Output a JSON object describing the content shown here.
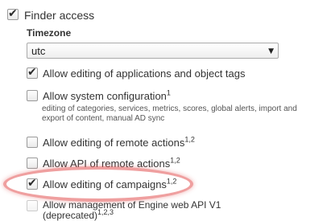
{
  "finder_access": {
    "label": "Finder access",
    "checked": true
  },
  "timezone": {
    "label": "Timezone",
    "value": "utc",
    "arrow": "▼"
  },
  "options": [
    {
      "label": "Allow editing of applications and object tags",
      "sup": "",
      "checked": true
    },
    {
      "label": "Allow system configuration",
      "sup": "1",
      "checked": false,
      "desc_line1": "editing of categories, services, metrics, scores, global alerts, import and",
      "desc_line2": "export of content, manual AD sync"
    },
    {
      "label": "Allow editing of remote actions",
      "sup": "1,2",
      "checked": false
    },
    {
      "label": "Allow API of remote actions",
      "sup": "1,2",
      "checked": false
    },
    {
      "label": "Allow editing of campaigns",
      "sup": "1,2",
      "checked": true
    },
    {
      "label_line1": "Allow management of Engine web API V1",
      "label_line2": "(deprecated)",
      "sup": "1,2,3",
      "checked": false
    }
  ],
  "check_glyph": "✔",
  "highlight_color": "#e05050"
}
